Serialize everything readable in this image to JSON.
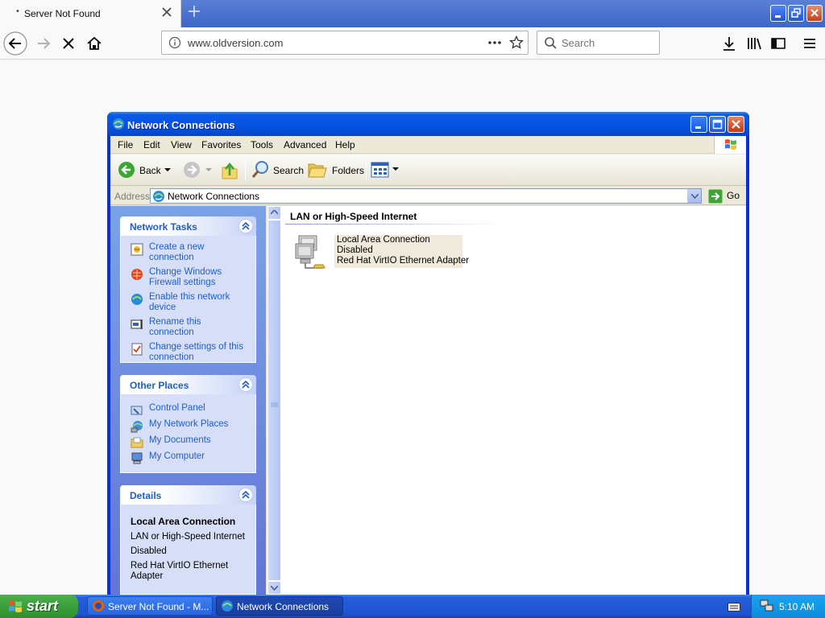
{
  "browser": {
    "tab_title": "Server Not Found",
    "new_tab_symbol": "+",
    "url": "www.oldversion.com",
    "search_placeholder": "Search"
  },
  "window": {
    "title": "Network Connections",
    "menu": [
      "File",
      "Edit",
      "View",
      "Favorites",
      "Tools",
      "Advanced",
      "Help"
    ],
    "toolbar": {
      "back": "Back",
      "search": "Search",
      "folders": "Folders"
    },
    "address": {
      "label": "Address",
      "value": "Network Connections",
      "go": "Go"
    }
  },
  "taskpane": {
    "network_tasks": {
      "title": "Network Tasks",
      "items": [
        "Create a new connection",
        "Change Windows Firewall settings",
        "Enable this network device",
        "Rename this connection",
        "Change settings of this connection"
      ]
    },
    "other_places": {
      "title": "Other Places",
      "items": [
        "Control Panel",
        "My Network Places",
        "My Documents",
        "My Computer"
      ]
    },
    "details": {
      "title": "Details",
      "name": "Local Area Connection",
      "type": "LAN or High-Speed Internet",
      "status": "Disabled",
      "adapter": "Red Hat VirtIO Ethernet Adapter"
    }
  },
  "content": {
    "group_title": "LAN or High-Speed Internet",
    "connection": {
      "name": "Local Area Connection",
      "status": "Disabled",
      "device": "Red Hat VirtIO Ethernet Adapter"
    }
  },
  "taskbar": {
    "start": "start",
    "buttons": [
      "Server Not Found - M...",
      "Network Connections"
    ],
    "clock": "5:10 AM"
  }
}
